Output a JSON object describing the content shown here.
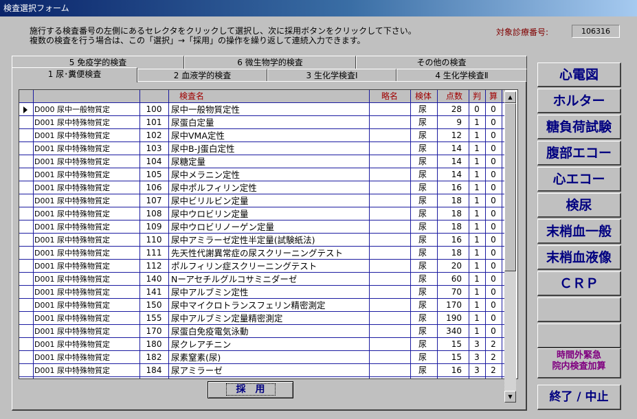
{
  "window": {
    "title": "検査選択フォーム"
  },
  "instructions": {
    "line1": "施行する検査番号の左側にあるセレクタをクリックして選択し、次に採用ボタンをクリックして下さい。",
    "line2": "複数の検査を行う場合は、この「選択」→「採用」の操作を繰り返して連続入力できます。"
  },
  "patient": {
    "label": "対象診療番号:",
    "value": "106316"
  },
  "tabs_back": [
    {
      "label": "5 免疫学的検査"
    },
    {
      "label": "6 微生物学的検査"
    },
    {
      "label": "その他の検査"
    }
  ],
  "tabs_front": [
    {
      "label": "1 尿･糞便検査",
      "active": true
    },
    {
      "label": "2 血液学的検査"
    },
    {
      "label": "3 生化学検査Ⅰ"
    },
    {
      "label": "4 生化学検査Ⅱ"
    }
  ],
  "table": {
    "headers": {
      "name": "検査名",
      "abbr": "略名",
      "specimen": "検体",
      "points": "点数",
      "judge": "判",
      "calc": "算"
    },
    "rows": [
      {
        "code": "D000 尿中一般物質定",
        "num": "100",
        "name": "尿中一般物質定性",
        "specimen": "尿",
        "points": "28",
        "judge": "0",
        "calc": "0"
      },
      {
        "code": "D001 尿中特殊物質定",
        "num": "101",
        "name": "尿蛋白定量",
        "specimen": "尿",
        "points": "9",
        "judge": "1",
        "calc": "0"
      },
      {
        "code": "D001 尿中特殊物質定",
        "num": "102",
        "name": "尿中VMA定性",
        "specimen": "尿",
        "points": "12",
        "judge": "1",
        "calc": "0"
      },
      {
        "code": "D001 尿中特殊物質定",
        "num": "103",
        "name": "尿中B-J蛋白定性",
        "specimen": "尿",
        "points": "14",
        "judge": "1",
        "calc": "0"
      },
      {
        "code": "D001 尿中特殊物質定",
        "num": "104",
        "name": "尿糖定量",
        "specimen": "尿",
        "points": "14",
        "judge": "1",
        "calc": "0"
      },
      {
        "code": "D001 尿中特殊物質定",
        "num": "105",
        "name": "尿中メラニン定性",
        "specimen": "尿",
        "points": "14",
        "judge": "1",
        "calc": "0"
      },
      {
        "code": "D001 尿中特殊物質定",
        "num": "106",
        "name": "尿中ポルフィリン定性",
        "specimen": "尿",
        "points": "16",
        "judge": "1",
        "calc": "0"
      },
      {
        "code": "D001 尿中特殊物質定",
        "num": "107",
        "name": "尿中ビリルビン定量",
        "specimen": "尿",
        "points": "18",
        "judge": "1",
        "calc": "0"
      },
      {
        "code": "D001 尿中特殊物質定",
        "num": "108",
        "name": "尿中ウロビリン定量",
        "specimen": "尿",
        "points": "18",
        "judge": "1",
        "calc": "0"
      },
      {
        "code": "D001 尿中特殊物質定",
        "num": "109",
        "name": "尿中ウロビリノーゲン定量",
        "specimen": "尿",
        "points": "18",
        "judge": "1",
        "calc": "0"
      },
      {
        "code": "D001 尿中特殊物質定",
        "num": "110",
        "name": "尿中アミラーゼ定性半定量(試験紙法)",
        "specimen": "尿",
        "points": "16",
        "judge": "1",
        "calc": "0"
      },
      {
        "code": "D001 尿中特殊物質定",
        "num": "111",
        "name": "先天性代謝異常症の尿スクリーニングテスト",
        "specimen": "尿",
        "points": "18",
        "judge": "1",
        "calc": "0"
      },
      {
        "code": "D001 尿中特殊物質定",
        "num": "112",
        "name": "ポルフィリン症スクリーニングテスト",
        "specimen": "尿",
        "points": "20",
        "judge": "1",
        "calc": "0"
      },
      {
        "code": "D001 尿中特殊物質定",
        "num": "140",
        "name": "Nーアセチルグルコサミニダーゼ",
        "specimen": "尿",
        "points": "60",
        "judge": "1",
        "calc": "0"
      },
      {
        "code": "D001 尿中特殊物質定",
        "num": "141",
        "name": "尿中アルブミン定性",
        "specimen": "尿",
        "points": "70",
        "judge": "1",
        "calc": "0"
      },
      {
        "code": "D001 尿中特殊物質定",
        "num": "150",
        "name": "尿中マイクロトランスフェリン精密測定",
        "specimen": "尿",
        "points": "170",
        "judge": "1",
        "calc": "0"
      },
      {
        "code": "D001 尿中特殊物質定",
        "num": "155",
        "name": "尿中アルブミン定量精密測定",
        "specimen": "尿",
        "points": "190",
        "judge": "1",
        "calc": "0"
      },
      {
        "code": "D001 尿中特殊物質定",
        "num": "170",
        "name": "尿蛋白免疫電気泳動",
        "specimen": "尿",
        "points": "340",
        "judge": "1",
        "calc": "0"
      },
      {
        "code": "D001 尿中特殊物質定",
        "num": "180",
        "name": "尿クレアチニン",
        "specimen": "尿",
        "points": "15",
        "judge": "3",
        "calc": "2"
      },
      {
        "code": "D001 尿中特殊物質定",
        "num": "182",
        "name": "尿素窒素(尿)",
        "specimen": "尿",
        "points": "15",
        "judge": "3",
        "calc": "2"
      },
      {
        "code": "D001 尿中特殊物質定",
        "num": "184",
        "name": "尿アミラーゼ",
        "specimen": "尿",
        "points": "16",
        "judge": "3",
        "calc": "2"
      }
    ]
  },
  "adopt_button": {
    "label": "採　用"
  },
  "right_buttons": [
    {
      "label": "心電図",
      "id": "ecg"
    },
    {
      "label": "ホルター",
      "id": "holter"
    },
    {
      "label": "糖負荷試験",
      "id": "glucose-tolerance"
    },
    {
      "label": "腹部エコー",
      "id": "abdominal-echo"
    },
    {
      "label": "心エコー",
      "id": "cardiac-echo"
    },
    {
      "label": "検尿",
      "id": "urinalysis"
    },
    {
      "label": "末梢血一般",
      "id": "peripheral-blood"
    },
    {
      "label": "末梢血液像",
      "id": "blood-smear"
    },
    {
      "label": "ＣＲＰ",
      "id": "crp"
    },
    {
      "label": "",
      "id": "blank-1"
    },
    {
      "label": "",
      "id": "blank-2"
    }
  ],
  "emergency_button": {
    "line1": "時間外緊急",
    "line2": "院内検査加算"
  },
  "exit_button": {
    "label": "終了 / 中止"
  },
  "colors": {
    "title_bar": "#0a246a",
    "header_text": "#a00000",
    "button_text": "#000080",
    "emergency_text": "#800080",
    "grid_lines": "#1a1aa0"
  }
}
